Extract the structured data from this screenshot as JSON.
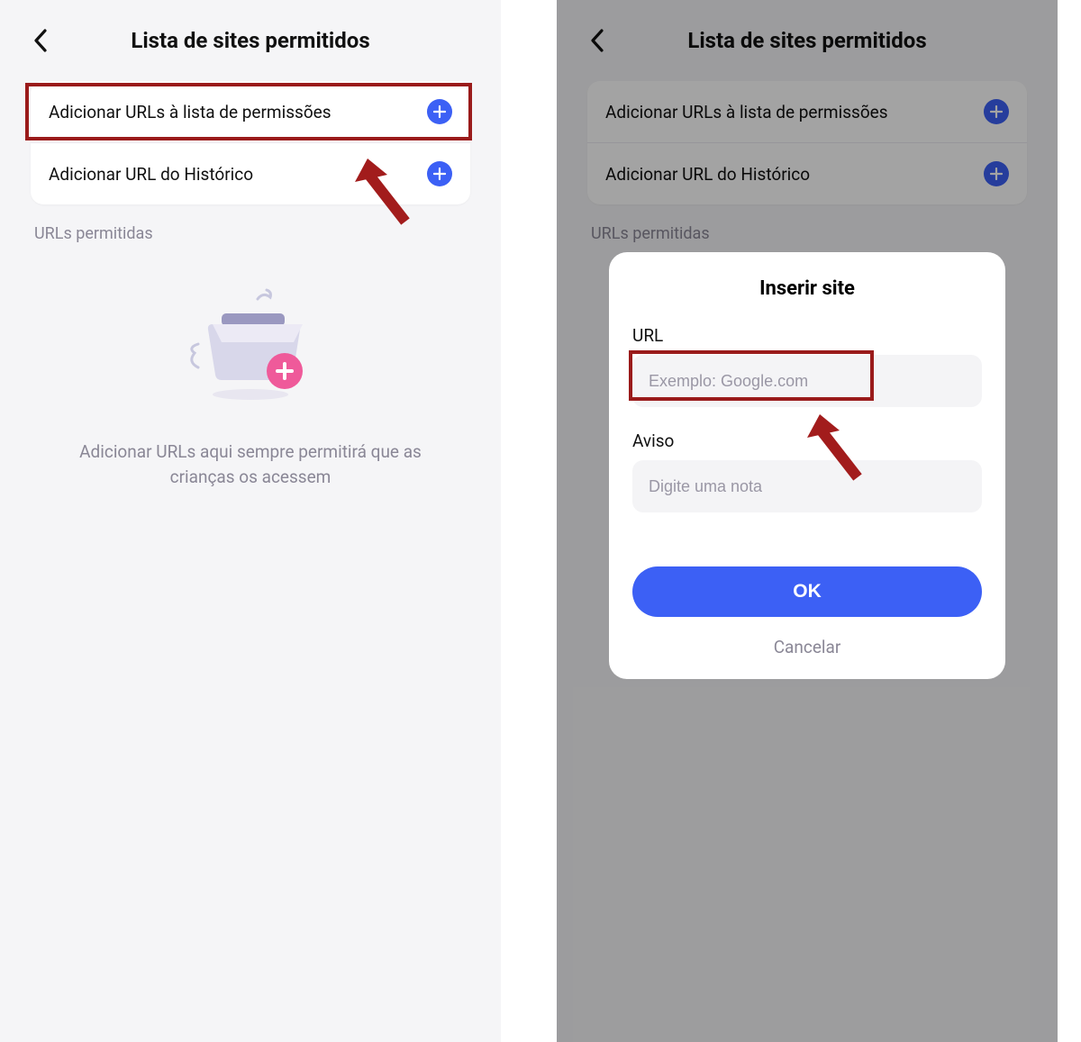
{
  "left": {
    "header_title": "Lista de sites permitidos",
    "row1_label": "Adicionar URLs à lista de permissões",
    "row2_label": "Adicionar URL do Histórico",
    "section_label": "URLs permitidas",
    "empty_text": "Adicionar URLs aqui sempre permitirá que as crianças os acessem"
  },
  "right": {
    "header_title": "Lista de sites permitidos",
    "row1_label": "Adicionar URLs à lista de permissões",
    "row2_label": "Adicionar URL do Histórico",
    "section_label": "URLs permitidas"
  },
  "modal": {
    "title": "Inserir site",
    "url_label": "URL",
    "url_placeholder": "Exemplo: Google.com",
    "note_label": "Aviso",
    "note_placeholder": "Digite uma nota",
    "ok": "OK",
    "cancel": "Cancelar"
  }
}
